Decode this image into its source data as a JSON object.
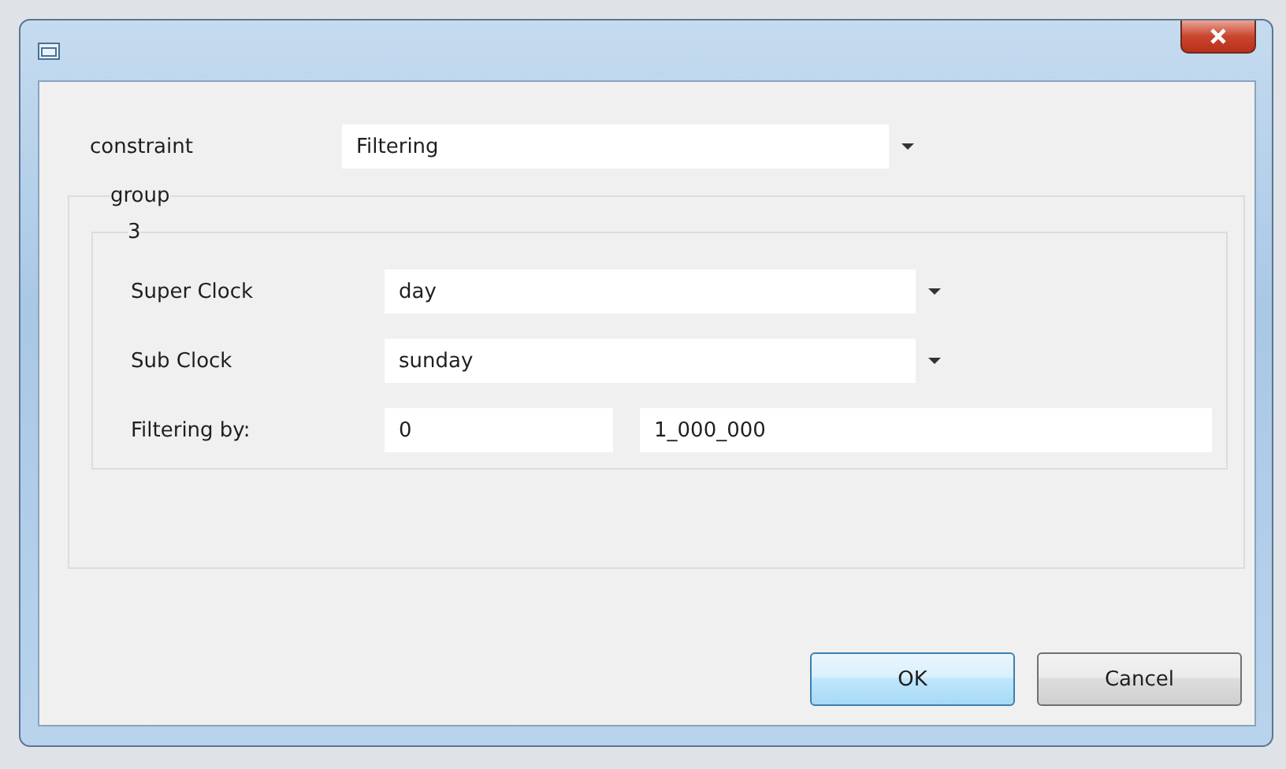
{
  "constraint": {
    "label": "constraint",
    "value": "Filtering"
  },
  "group": {
    "title": "group",
    "subgroup": {
      "title": "3",
      "rows": [
        {
          "kind": "combo",
          "label": "Super Clock",
          "value": "day"
        },
        {
          "kind": "combo",
          "label": "Sub Clock",
          "value": "sunday"
        },
        {
          "kind": "range",
          "label": "Filtering by:",
          "from": "0",
          "to": "1_000_000"
        }
      ]
    }
  },
  "buttons": [
    {
      "label": "OK",
      "default": true
    },
    {
      "label": "Cancel",
      "default": false
    }
  ]
}
